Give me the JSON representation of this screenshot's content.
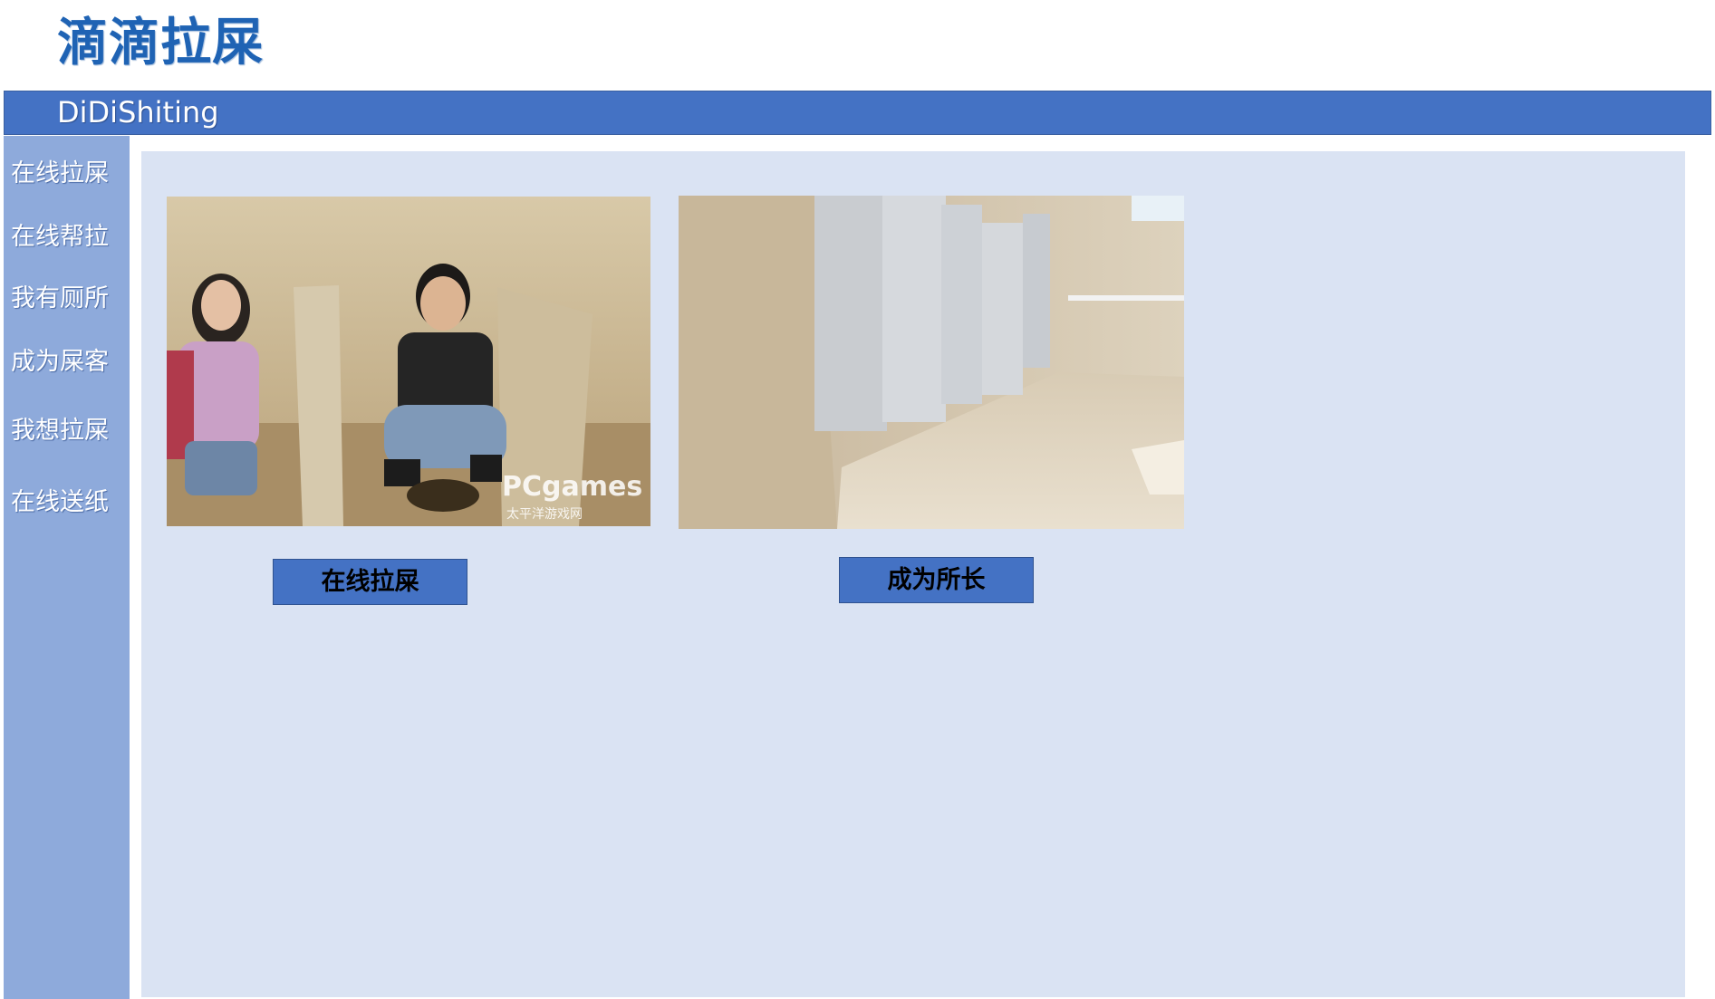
{
  "header": {
    "title": "滴滴拉屎",
    "subtitle": "DiDiShiting"
  },
  "sidebar": {
    "items": [
      {
        "label": "在线拉屎"
      },
      {
        "label": "在线帮拉"
      },
      {
        "label": "我有厕所"
      },
      {
        "label": "成为屎客"
      },
      {
        "label": "我想拉屎"
      },
      {
        "label": "在线送纸"
      }
    ]
  },
  "main": {
    "cards": [
      {
        "image": "people-squatting-latrine-photo",
        "watermark": "PCgames",
        "watermark_sub": "太平洋游戏网",
        "button_label": "在线拉屎"
      },
      {
        "image": "restroom-stalls-photo",
        "button_label": "成为所长"
      }
    ]
  },
  "colors": {
    "brand_title": "#1f63b4",
    "top_bar": "#4472c4",
    "sidebar": "#8eaadb",
    "content_bg": "#dae3f3",
    "button": "#4472c4"
  }
}
